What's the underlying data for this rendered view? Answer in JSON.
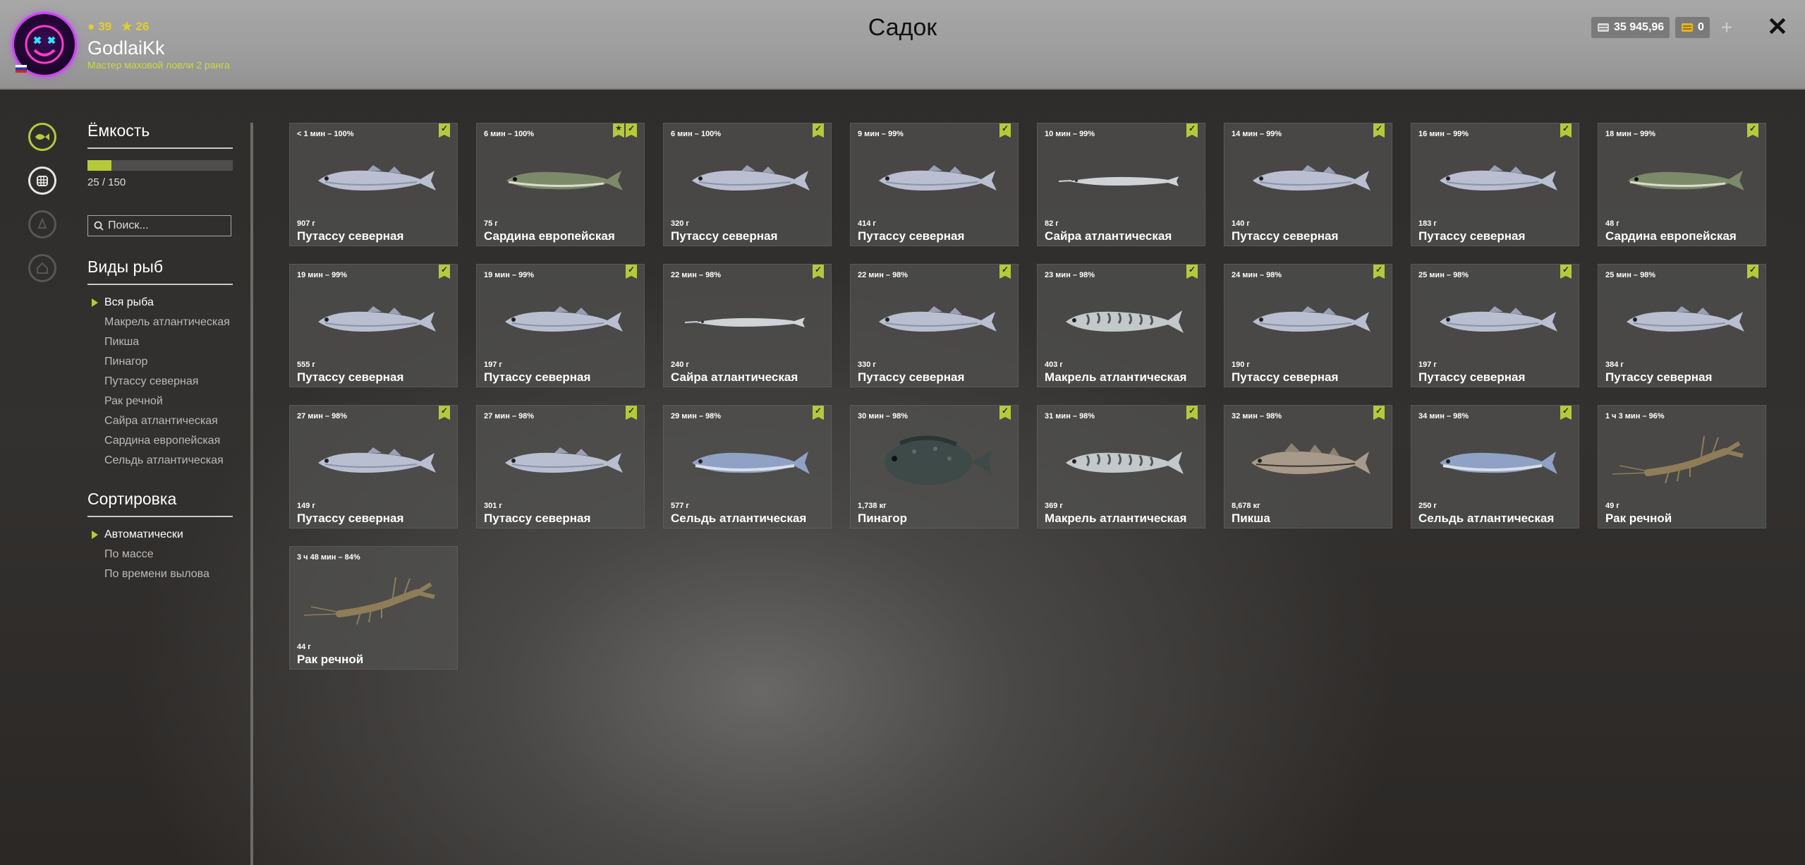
{
  "header": {
    "title": "Садок",
    "player": {
      "name": "GodlaiKk",
      "rank": "Мастер маховой ловли 2 ранга",
      "level_a": "39",
      "level_b": "26"
    },
    "silver": "35 945,96",
    "gold": "0"
  },
  "sidebar": {
    "capacity_title": "Ёмкость",
    "capacity_text": "25 / 150",
    "capacity_fraction": 0.1667,
    "search_placeholder": "Поиск...",
    "species_title": "Виды рыб",
    "species": [
      "Вся рыба",
      "Макрель атлантическая",
      "Пикша",
      "Пинагор",
      "Путассу северная",
      "Рак речной",
      "Сайра атлантическая",
      "Сардина европейская",
      "Сельдь атлантическая"
    ],
    "sort_title": "Сортировка",
    "sort": [
      "Автоматически",
      "По массе",
      "По времени вылова"
    ]
  },
  "colors": {
    "accent": "#b6c93b",
    "header_bg": "#9d9d9d"
  },
  "catches": [
    {
      "time": "< 1 мин – 100%",
      "weight": "907 г",
      "name": "Путассу северная",
      "kind": "whiting",
      "star": false
    },
    {
      "time": "6 мин – 100%",
      "weight": "75 г",
      "name": "Сардина европейская",
      "kind": "sardine",
      "star": true
    },
    {
      "time": "6 мин – 100%",
      "weight": "320 г",
      "name": "Путассу северная",
      "kind": "whiting",
      "star": false
    },
    {
      "time": "9 мин – 99%",
      "weight": "414 г",
      "name": "Путассу северная",
      "kind": "whiting",
      "star": false
    },
    {
      "time": "10 мин – 99%",
      "weight": "82 г",
      "name": "Сайра атлантическая",
      "kind": "saury",
      "star": false
    },
    {
      "time": "14 мин – 99%",
      "weight": "140 г",
      "name": "Путассу северная",
      "kind": "whiting",
      "star": false
    },
    {
      "time": "16 мин – 99%",
      "weight": "183 г",
      "name": "Путассу северная",
      "kind": "whiting",
      "star": false
    },
    {
      "time": "18 мин – 99%",
      "weight": "48 г",
      "name": "Сардина европейская",
      "kind": "sardine",
      "star": false
    },
    {
      "time": "19 мин – 99%",
      "weight": "555 г",
      "name": "Путассу северная",
      "kind": "whiting",
      "star": false
    },
    {
      "time": "19 мин – 99%",
      "weight": "197 г",
      "name": "Путассу северная",
      "kind": "whiting",
      "star": false
    },
    {
      "time": "22 мин – 98%",
      "weight": "240 г",
      "name": "Сайра атлантическая",
      "kind": "saury",
      "star": false
    },
    {
      "time": "22 мин – 98%",
      "weight": "330 г",
      "name": "Путассу северная",
      "kind": "whiting",
      "star": false
    },
    {
      "time": "23 мин – 98%",
      "weight": "403 г",
      "name": "Макрель атлантическая",
      "kind": "mackerel",
      "star": false
    },
    {
      "time": "24 мин – 98%",
      "weight": "190 г",
      "name": "Путассу северная",
      "kind": "whiting",
      "star": false
    },
    {
      "time": "25 мин – 98%",
      "weight": "197 г",
      "name": "Путассу северная",
      "kind": "whiting",
      "star": false
    },
    {
      "time": "25 мин – 98%",
      "weight": "384 г",
      "name": "Путассу северная",
      "kind": "whiting",
      "star": false
    },
    {
      "time": "27 мин – 98%",
      "weight": "149 г",
      "name": "Путассу северная",
      "kind": "whiting",
      "star": false
    },
    {
      "time": "27 мин – 98%",
      "weight": "301 г",
      "name": "Путассу северная",
      "kind": "whiting",
      "star": false
    },
    {
      "time": "29 мин – 98%",
      "weight": "577 г",
      "name": "Сельдь атлантическая",
      "kind": "herring",
      "star": false
    },
    {
      "time": "30 мин – 98%",
      "weight": "1,738 кг",
      "name": "Пинагор",
      "kind": "lumpfish",
      "star": false
    },
    {
      "time": "31 мин – 98%",
      "weight": "369 г",
      "name": "Макрель атлантическая",
      "kind": "mackerel",
      "star": false
    },
    {
      "time": "32 мин – 98%",
      "weight": "8,678 кг",
      "name": "Пикша",
      "kind": "haddock",
      "star": false
    },
    {
      "time": "34 мин – 98%",
      "weight": "250 г",
      "name": "Сельдь атлантическая",
      "kind": "herring",
      "star": false
    },
    {
      "time": "1 ч 3 мин – 96%",
      "weight": "49 г",
      "name": "Рак речной",
      "kind": "crayfish",
      "star": false,
      "nocheck": true
    },
    {
      "time": "3 ч 48 мин – 84%",
      "weight": "44 г",
      "name": "Рак речной",
      "kind": "crayfish",
      "star": false,
      "nocheck": true
    }
  ]
}
